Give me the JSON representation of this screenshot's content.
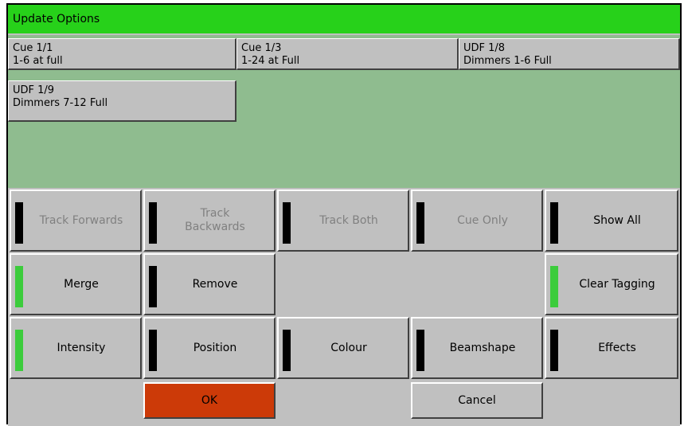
{
  "window": {
    "title": "Update Options"
  },
  "cues": [
    {
      "title": "Cue 1/1",
      "subtitle": "1-6 at full"
    },
    {
      "title": "Cue 1/3",
      "subtitle": "1-24 at Full"
    },
    {
      "title": "UDF 1/8",
      "subtitle": "Dimmers 1-6 Full"
    },
    {
      "title": "UDF 1/9",
      "subtitle": "Dimmers 7-12 Full"
    }
  ],
  "tracking": [
    {
      "label": "Track Forwards",
      "state": "off",
      "enabled": false
    },
    {
      "label": "Track Backwards",
      "state": "off",
      "enabled": false
    },
    {
      "label": "Track Both",
      "state": "off",
      "enabled": false
    },
    {
      "label": "Cue Only",
      "state": "off",
      "enabled": false
    },
    {
      "label": "Show All",
      "state": "off",
      "enabled": true
    }
  ],
  "mode": {
    "merge": {
      "label": "Merge",
      "state": "on"
    },
    "remove": {
      "label": "Remove",
      "state": "off"
    },
    "clear_tagging": {
      "label": "Clear Tagging",
      "state": "on"
    }
  },
  "attributes": [
    {
      "label": "Intensity",
      "state": "on"
    },
    {
      "label": "Position",
      "state": "off"
    },
    {
      "label": "Colour",
      "state": "off"
    },
    {
      "label": "Beamshape",
      "state": "off"
    },
    {
      "label": "Effects",
      "state": "off"
    }
  ],
  "actions": {
    "ok": "OK",
    "cancel": "Cancel"
  },
  "colors": {
    "title_bar": "#27d11a",
    "list_bg": "#8fbc8f",
    "button_face": "#c0c0c0",
    "indicator_on": "#3ccc3c",
    "indicator_off": "#000000",
    "ok_button": "#cc3a08"
  }
}
